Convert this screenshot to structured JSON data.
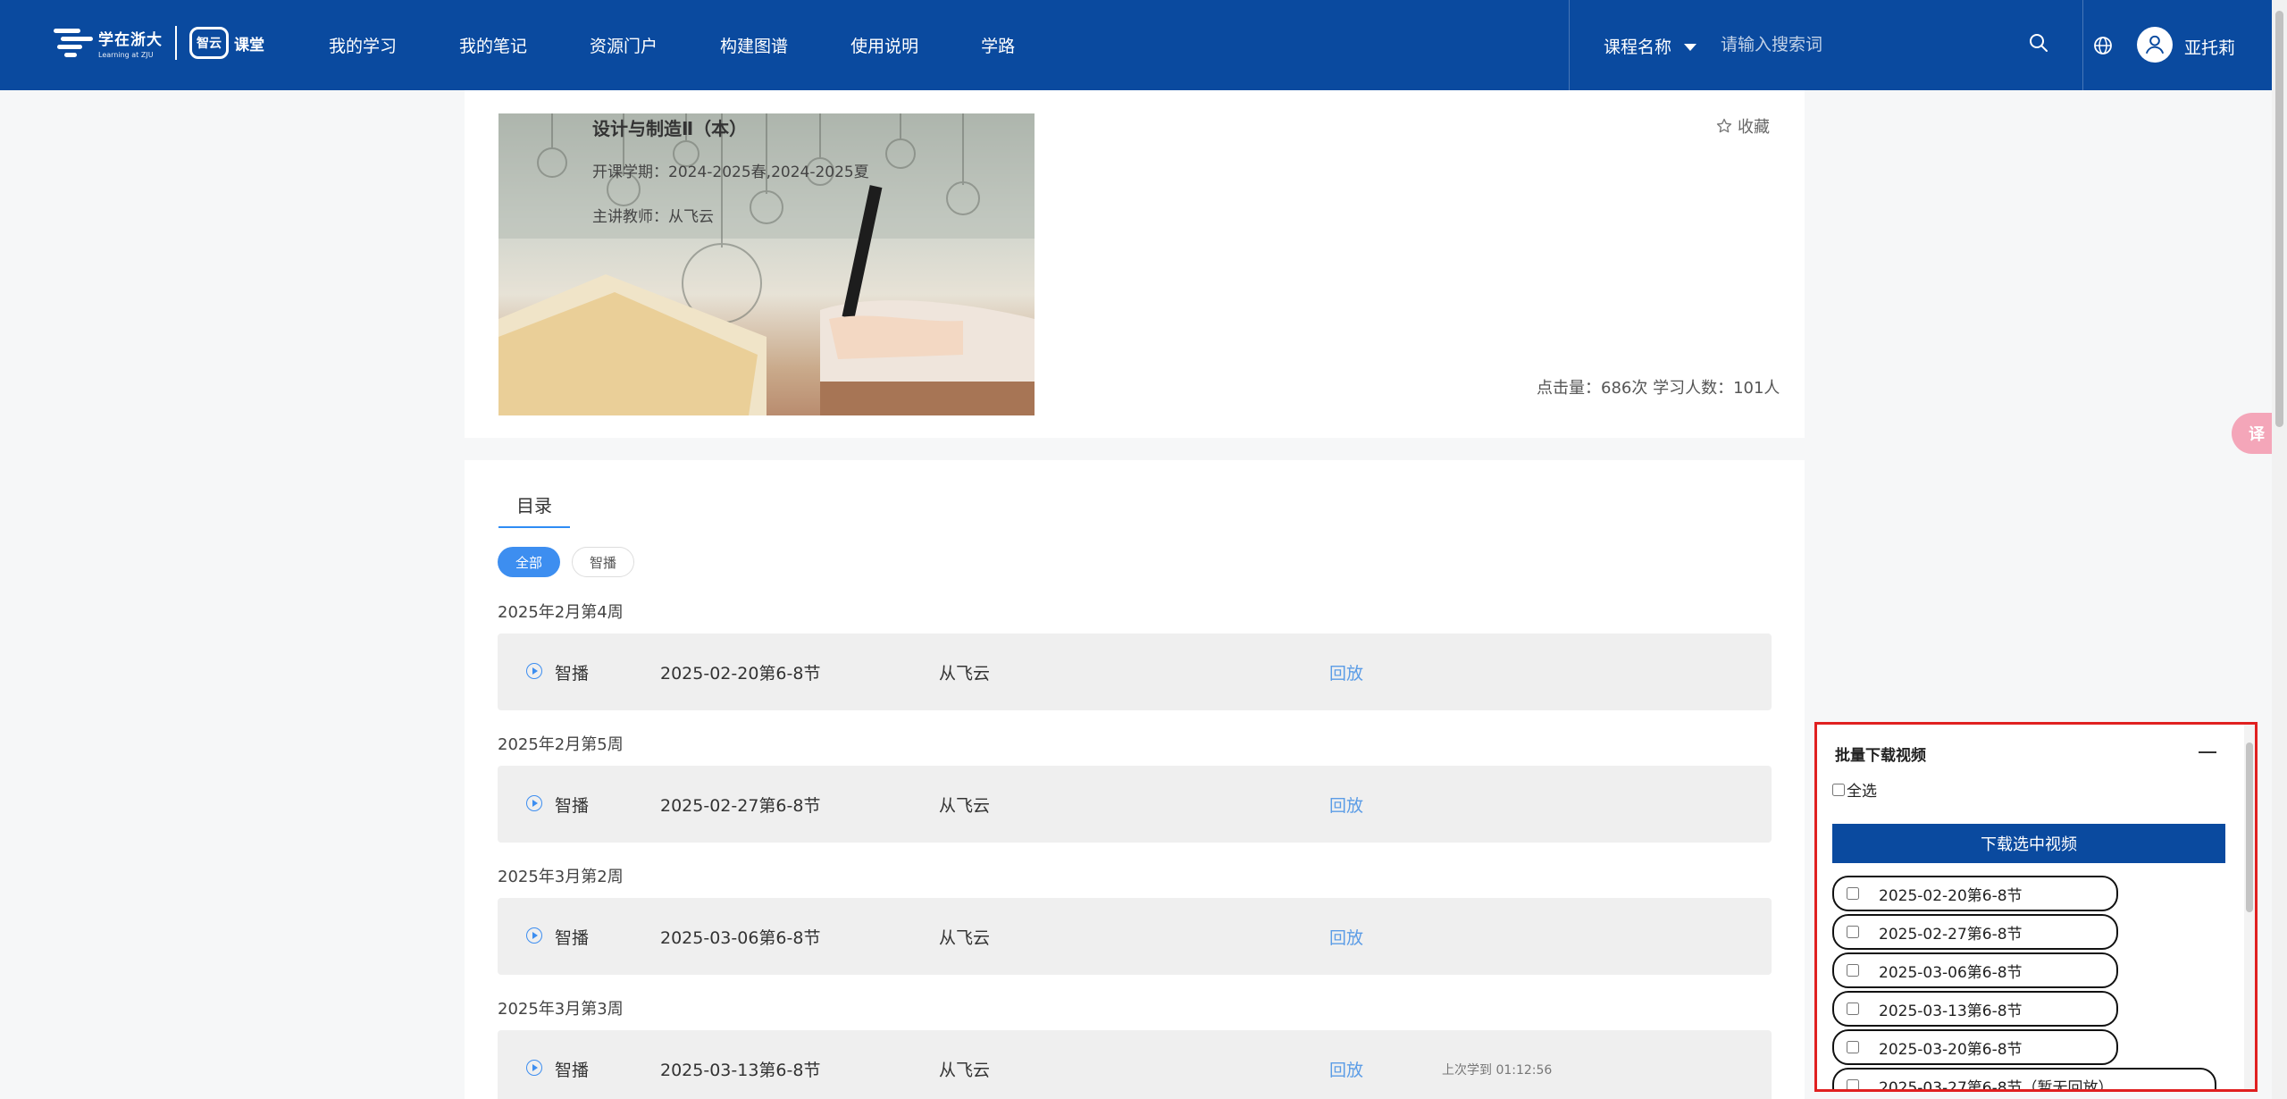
{
  "header": {
    "logo_title": "学在浙大",
    "logo_sub": "Learning at ZJU",
    "logo_cloud": "智云",
    "logo_course": "课堂",
    "nav": [
      "我的学习",
      "我的笔记",
      "资源门户",
      "构建图谱",
      "使用说明",
      "学路"
    ],
    "search_category": "课程名称",
    "search_placeholder": "请输入搜索词",
    "username": "亚托莉"
  },
  "course": {
    "title": "设计与制造Ⅱ（本）",
    "term": "开课学期：2024-2025春,2024-2025夏",
    "teacher": "主讲教师：从飞云",
    "favorite": "收藏",
    "stats": "点击量：686次 学习人数：101人"
  },
  "catalog": {
    "tab": "目录",
    "filters": [
      "全部",
      "智播"
    ],
    "weeks": [
      {
        "label": "2025年2月第4周",
        "type": "智播",
        "date": "2025-02-20第6-8节",
        "teacher": "从飞云",
        "action": "回放",
        "last": ""
      },
      {
        "label": "2025年2月第5周",
        "type": "智播",
        "date": "2025-02-27第6-8节",
        "teacher": "从飞云",
        "action": "回放",
        "last": ""
      },
      {
        "label": "2025年3月第2周",
        "type": "智播",
        "date": "2025-03-06第6-8节",
        "teacher": "从飞云",
        "action": "回放",
        "last": ""
      },
      {
        "label": "2025年3月第3周",
        "type": "智播",
        "date": "2025-03-13第6-8节",
        "teacher": "从飞云",
        "action": "回放",
        "last": "上次学到 01:12:56"
      }
    ]
  },
  "float_button": "译",
  "panel": {
    "title": "批量下载视频",
    "select_all": "全选",
    "download_button": "下载选中视频",
    "items": [
      "2025-02-20第6-8节",
      "2025-02-27第6-8节",
      "2025-03-06第6-8节",
      "2025-03-13第6-8节",
      "2025-03-20第6-8节",
      "2025-03-27第6-8节（暂无回放）"
    ]
  },
  "colors": {
    "header": "#0a4a9f",
    "accent": "#3d8ef0",
    "link": "#5b9ce6",
    "panel_border": "#e02020"
  }
}
